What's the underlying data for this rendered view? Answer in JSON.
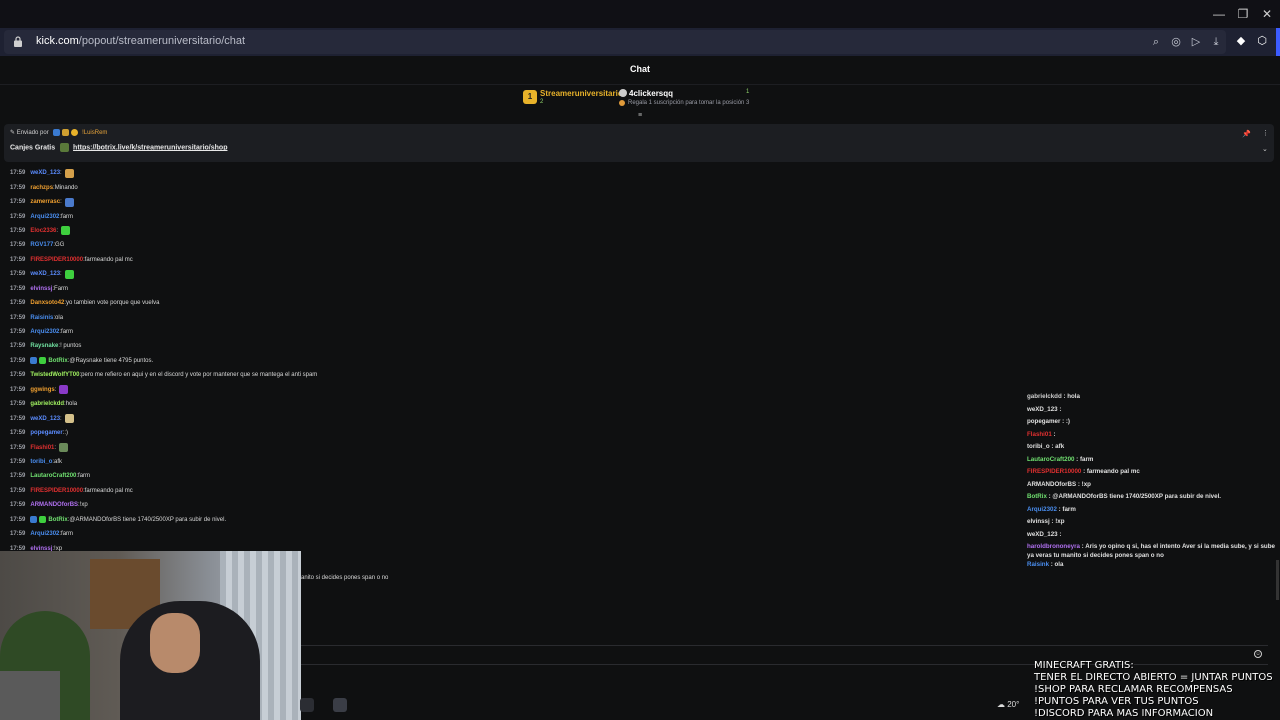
{
  "browser": {
    "url_domain": "kick.com",
    "url_path": "/popout/streameruniversitario/chat"
  },
  "chat": {
    "title": "Chat"
  },
  "leaderboard": {
    "first": {
      "rank": "1",
      "name": "Streameruniversitario",
      "count": "2"
    },
    "second": {
      "name": "4clickersqq",
      "count": "1",
      "note": "Regala 1 suscripción para tomar la posición 3"
    }
  },
  "pinned": {
    "sent_by_label": "Enviado por",
    "sent_by_user": "!LuisRem",
    "label": "Canjes Gratis",
    "link": "https://botrix.live/k/streameruniversitario/shop"
  },
  "messages": [
    {
      "time": "17:59",
      "user": "weXD_123",
      "color": "#5b8cff",
      "text": "",
      "emote": "#d4a04a"
    },
    {
      "time": "17:59",
      "user": "rachzps",
      "color": "#f0a030",
      "text": "Minando"
    },
    {
      "time": "17:59",
      "user": "zamerrasc",
      "color": "#f0a030",
      "text": "",
      "emote": "#4a7acc"
    },
    {
      "time": "17:59",
      "user": "Arqui2302",
      "color": "#4a8ef0",
      "text": "farm"
    },
    {
      "time": "17:59",
      "user": "Eloc2336",
      "color": "#e03030",
      "text": "",
      "emote": "#3ecf3e"
    },
    {
      "time": "17:59",
      "user": "RGV177",
      "color": "#4a8ef0",
      "text": "GG"
    },
    {
      "time": "17:59",
      "user": "FIRESPIDER10000",
      "color": "#e03030",
      "text": "farmeando pal mc"
    },
    {
      "time": "17:59",
      "user": "weXD_123",
      "color": "#5b8cff",
      "text": "",
      "emote": "#3ecf3e"
    },
    {
      "time": "17:59",
      "user": "elvinssj",
      "color": "#b070f0",
      "text": "Farm"
    },
    {
      "time": "17:59",
      "user": "Danxsoto42",
      "color": "#f0a030",
      "text": "yo tambien vote porque que vuelva"
    },
    {
      "time": "17:59",
      "user": "Raisinis",
      "color": "#4a8ef0",
      "text": "ola"
    },
    {
      "time": "17:59",
      "user": "Arqui2302",
      "color": "#4a8ef0",
      "text": "farm"
    },
    {
      "time": "17:59",
      "user": "Raysnake",
      "color": "#70e0a0",
      "text": "! puntos"
    },
    {
      "time": "17:59",
      "user": "BotRix",
      "color": "#70e070",
      "text": "@Raysnake tiene 4795 puntos."
    },
    {
      "time": "17:59",
      "user": "TwistedWolfYT00",
      "color": "#a0f060",
      "text": "pero me refiero en aqui y en el discord y vote por mantener que se mantega el anti spam"
    },
    {
      "time": "17:59",
      "user": "ggwings",
      "color": "#f0a030",
      "text": "",
      "emote": "#8a3ac8"
    },
    {
      "time": "17:59",
      "user": "gabrielckdd",
      "color": "#a0f060",
      "text": "hola"
    },
    {
      "time": "17:59",
      "user": "weXD_123",
      "color": "#5b8cff",
      "text": "",
      "emote": "#d4c08a"
    },
    {
      "time": "17:59",
      "user": "popegamer",
      "color": "#5b8cff",
      "text": ":)"
    },
    {
      "time": "17:59",
      "user": "Flashi01",
      "color": "#e03030",
      "text": "",
      "emote": "#6a8a5a"
    },
    {
      "time": "17:59",
      "user": "toribi_o",
      "color": "#4a8ef0",
      "text": "afk"
    },
    {
      "time": "17:59",
      "user": "LautaroCraft200",
      "color": "#70e070",
      "text": "farm"
    },
    {
      "time": "17:59",
      "user": "FIRESPIDER10000",
      "color": "#e03030",
      "text": "farmeando pal mc"
    },
    {
      "time": "17:59",
      "user": "ARMANDOforBS",
      "color": "#b070f0",
      "text": "!xp"
    },
    {
      "time": "17:59",
      "user": "BotRix",
      "color": "#70e070",
      "text": "@ARMANDOforBS tiene 1740/2500XP para subir de nivel."
    },
    {
      "time": "17:59",
      "user": "Arqui2302",
      "color": "#4a8ef0",
      "text": "farm"
    },
    {
      "time": "17:59",
      "user": "elvinssj",
      "color": "#b070f0",
      "text": "!xp"
    }
  ],
  "cut_message": "anito si decides pones span o no",
  "overlay_chat": [
    {
      "user": "gabrielckdd",
      "color": "#cfcfcf",
      "text": "hola"
    },
    {
      "user": "weXD_123",
      "color": "#e0e0e0",
      "text": ""
    },
    {
      "user": "popegamer",
      "color": "#e0e0e0",
      "text": ":)"
    },
    {
      "user": "Flashi01",
      "color": "#e03030",
      "text": ""
    },
    {
      "user": "toribi_o",
      "color": "#e0e0e0",
      "text": "afk"
    },
    {
      "user": "LautaroCraft200",
      "color": "#70e070",
      "text": "farm"
    },
    {
      "user": "FIRESPIDER10000",
      "color": "#e03030",
      "text": "farmeando pal mc"
    },
    {
      "user": "ARMANDOforBS",
      "color": "#e0e0e0",
      "text": "!xp"
    },
    {
      "user": "BotRix",
      "color": "#70e070",
      "text": "@ARMANDOforBS tiene 1740/2500XP para subir de nivel."
    },
    {
      "user": "Arqui2302",
      "color": "#4a8ef0",
      "text": "farm"
    },
    {
      "user": "elvinssj",
      "color": "#e0e0e0",
      "text": "!xp"
    },
    {
      "user": "weXD_123",
      "color": "#e0e0e0",
      "text": ""
    },
    {
      "user": "haroldbrononeyra",
      "color": "#b070f0",
      "text": "Aris yo opino q si, has el intento Aver si la media sube, y si sube ya veras tu manito si decides pones span o no"
    },
    {
      "user": "Raisink",
      "color": "#4a8ef0",
      "text": "ola"
    }
  ],
  "promo": {
    "lines": [
      "MINECRAFT GRATIS:",
      "TENER EL DIRECTO ABIERTO = JUNTAR PUNTOS",
      "!SHOP PARA RECLAMAR RECOMPENSAS",
      "!PUNTOS PARA VER TUS PUNTOS",
      "!DISCORD PARA MAS INFORMACION"
    ]
  },
  "weather": {
    "temp": "20°"
  },
  "colors": {
    "accent": "#53fc18",
    "pinned_bg": "#1c1e22",
    "bg": "#0f1011"
  }
}
